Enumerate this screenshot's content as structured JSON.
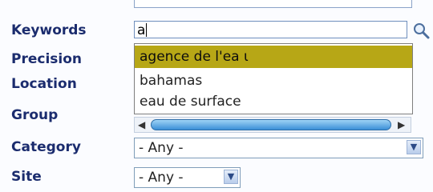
{
  "labels": {
    "keywords": "Keywords",
    "precision": "Precision",
    "location": "Location",
    "group": "Group",
    "category": "Category",
    "site": "Site"
  },
  "keywords": {
    "value": "a",
    "suggestions": [
      "agence de l'ea ι",
      "bahamas",
      "eau de surface"
    ],
    "selected_index": 0,
    "highlight_color": "#b7a716"
  },
  "category": {
    "selected": "- Any -"
  },
  "site": {
    "selected": "- Any -"
  },
  "icons": {
    "search": "search-icon",
    "scroll_left": "arrow-left-icon",
    "scroll_right": "arrow-right-icon",
    "select_arrow": "chevron-down-icon"
  }
}
